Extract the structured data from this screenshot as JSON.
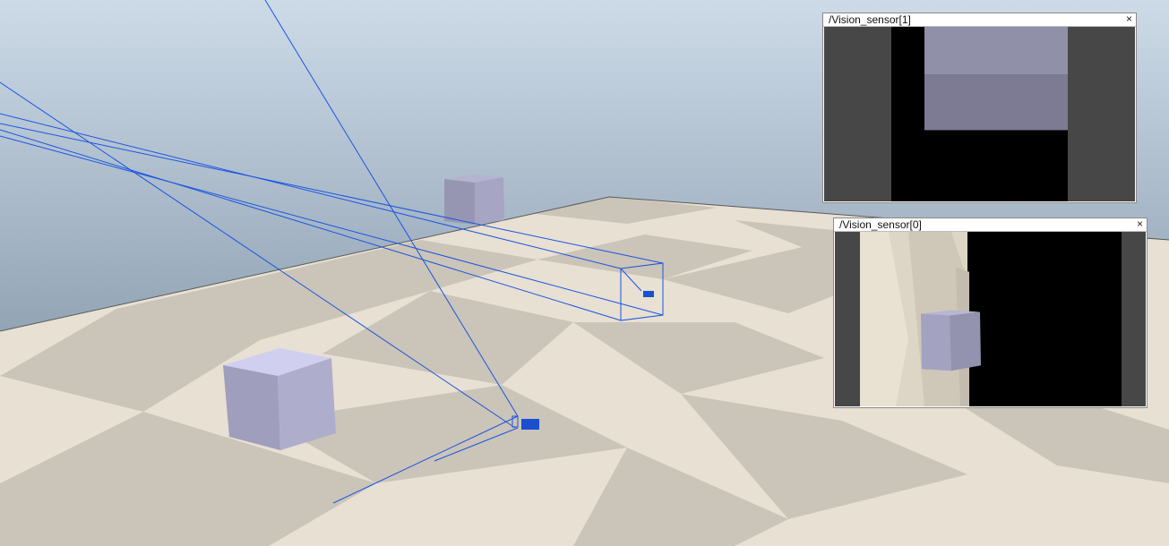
{
  "scene": {
    "sky_top_color": "#cddbe8",
    "sky_bottom_color": "#6f7e8d",
    "floor_light_color": "#e7e0d3",
    "floor_dark_color": "#c9c2b6",
    "cube_color": "#9b9ab8",
    "frustum_color": "#1a55e0",
    "sensor_color": "#1a4fd0"
  },
  "floating_views": [
    {
      "title": "/Vision_sensor[1]",
      "close_label": "×"
    },
    {
      "title": "/Vision_sensor[0]",
      "close_label": "×"
    }
  ]
}
